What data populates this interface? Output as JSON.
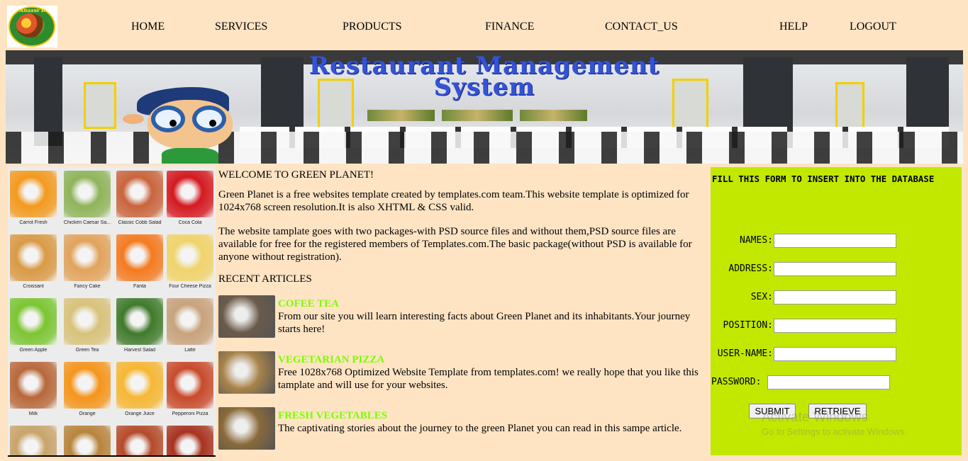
{
  "logo": {
    "text": "Anaase D",
    "alt": "restaurant-logo"
  },
  "nav": {
    "home": "HOME",
    "services": "SERVICES",
    "products": "PRODUCTS",
    "finance": "FINANCE",
    "contact": "CONTACT_US",
    "help": "HELP",
    "logout": "LOGOUT"
  },
  "banner": {
    "line1": "Restaurant Management",
    "line2": "System"
  },
  "menu_items": [
    {
      "label": "Carrot Fresh",
      "color": "#f39a1e"
    },
    {
      "label": "Chicken Caesar Sa...",
      "color": "#8fb45a"
    },
    {
      "label": "Classic Cobb Salad",
      "color": "#c9643c"
    },
    {
      "label": "Coca Cola",
      "color": "#d41920"
    },
    {
      "label": "Croissant",
      "color": "#d99a45"
    },
    {
      "label": "Fancy Cake",
      "color": "#e2a35c"
    },
    {
      "label": "Fanta",
      "color": "#f47a1f"
    },
    {
      "label": "Four Cheese Pizza",
      "color": "#f0d36a"
    },
    {
      "label": "Green Apple",
      "color": "#7cc532"
    },
    {
      "label": "Green Tea",
      "color": "#d8c27a"
    },
    {
      "label": "Harvest Salad",
      "color": "#3f7a2a"
    },
    {
      "label": "Latte",
      "color": "#c8a27c"
    },
    {
      "label": "Milk",
      "color": "#b8683a"
    },
    {
      "label": "Orange",
      "color": "#f5951a"
    },
    {
      "label": "Orange Juice",
      "color": "#f6b733"
    },
    {
      "label": "Pepperoni Pizza",
      "color": "#c84a2a"
    },
    {
      "label": "",
      "color": "#c9a46a"
    },
    {
      "label": "",
      "color": "#b8843c"
    },
    {
      "label": "",
      "color": "#b44a2a"
    },
    {
      "label": "",
      "color": "#a8321e"
    }
  ],
  "main": {
    "welcome": "WELCOME TO GREEN PLANET!",
    "para1": "Green Planet is a free websites template created by templates.com team.This website template is optimized for 1024x768 screen resolution.It is also XHTML & CSS valid.",
    "para2": "The website tamplate goes with two packages-with PSD source files and without them,PSD source files are available for free for the registered members of Templates.com.The basic package(without PSD is available for anyone without registration).",
    "recent": "RECENT ARTICLES",
    "articles": [
      {
        "title": "COFEE TEA",
        "body": "From our site you will learn interesting facts about Green Planet and its inhabitants.Your journey starts here!",
        "color": "#6b5a4a"
      },
      {
        "title": "VEGETARIAN PIZZA",
        "body": "Free 1028x768 Optimized Website Template from templates.com! we really hope that you like this tamplate and will use for your websites.",
        "color": "#a8834a"
      },
      {
        "title": "FRESH VEGETABLES",
        "body": "The captivating stories about the journey to the green Planet you can read in this sampe article.",
        "color": "#8a6a3a"
      }
    ]
  },
  "form": {
    "title": "FILL THIS FORM TO INSERT INTO THE DATABASE",
    "names_label": "NAMES:",
    "address_label": "ADDRESS:",
    "sex_label": "SEX:",
    "position_label": "POSITION:",
    "username_label": "USER-NAME:",
    "password_label": "PASSWORD:",
    "names_value": "",
    "address_value": "",
    "sex_value": "",
    "position_value": "",
    "username_value": "",
    "password_value": "",
    "submit": "SUBMIT",
    "retrieve": "RETRIEVE",
    "bg_color": "#c2e800"
  },
  "watermark": {
    "line1": "Activate Windows",
    "line2": "Go to Settings to activate Windows."
  }
}
